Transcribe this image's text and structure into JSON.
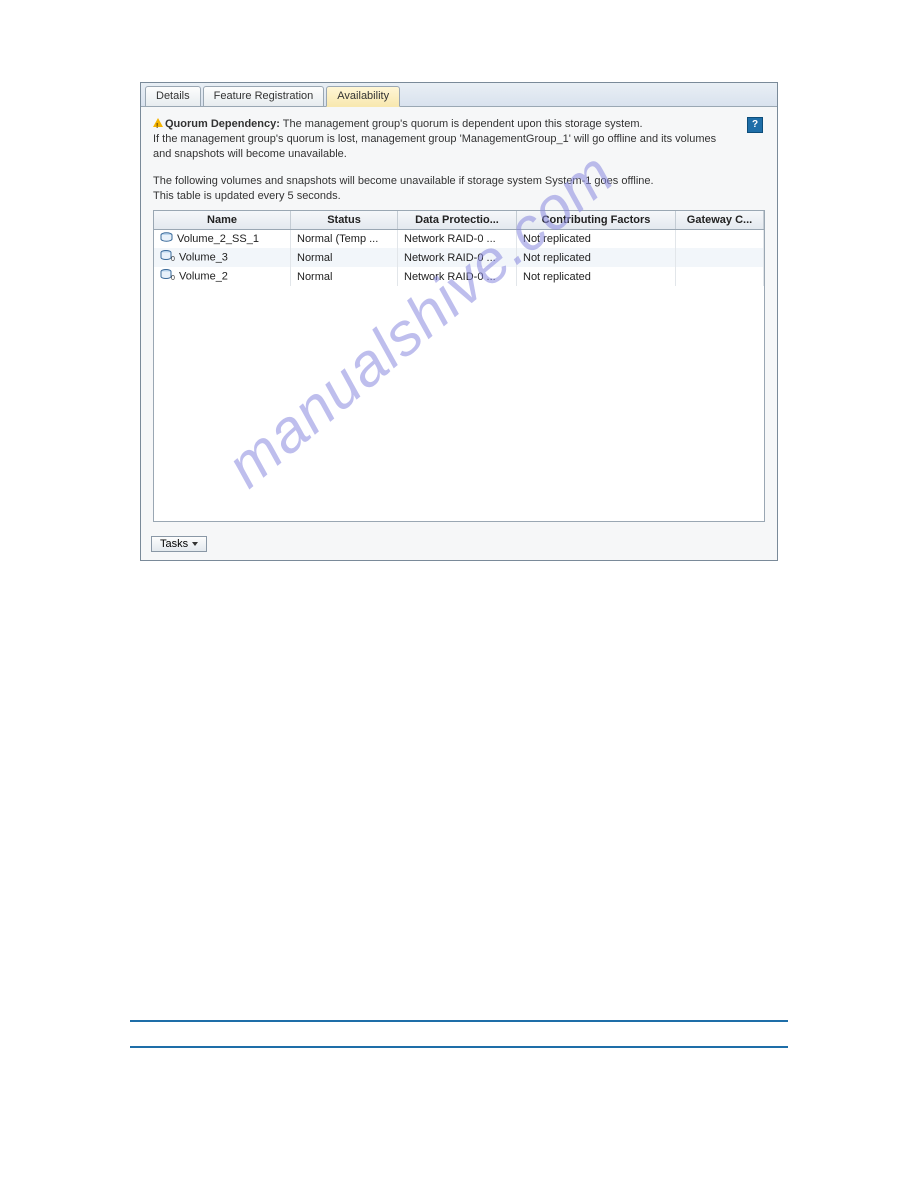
{
  "tabs": {
    "details": "Details",
    "feature_registration": "Feature Registration",
    "availability": "Availability"
  },
  "warning": {
    "title": "Quorum Dependency:",
    "line1_rest": " The management group's quorum is dependent upon this storage system.",
    "line2": "If the management group's quorum is lost, management group 'ManagementGroup_1' will go offline and its volumes",
    "line3": "and snapshots will become unavailable."
  },
  "info": {
    "line1": "The following volumes and snapshots will become unavailable if storage system System-1 goes offline.",
    "line2": "This table is updated every 5 seconds."
  },
  "help_label": "?",
  "table": {
    "headers": {
      "name": "Name",
      "status": "Status",
      "data_protection": "Data Protectio...",
      "contributing_factors": "Contributing Factors",
      "gateway_c": "Gateway C..."
    },
    "rows": [
      {
        "icon": "snapshot",
        "name": "Volume_2_SS_1",
        "status": "Normal (Temp ...",
        "dp": "Network RAID-0 ...",
        "cf": "Not replicated",
        "gc": ""
      },
      {
        "icon": "volume",
        "name": "Volume_3",
        "status": "Normal",
        "dp": "Network RAID-0 ...",
        "cf": "Not replicated",
        "gc": ""
      },
      {
        "icon": "volume",
        "name": "Volume_2",
        "status": "Normal",
        "dp": "Network RAID-0 ...",
        "cf": "Not replicated",
        "gc": ""
      }
    ]
  },
  "tasks_label": "Tasks",
  "watermark": "manualshive.com"
}
